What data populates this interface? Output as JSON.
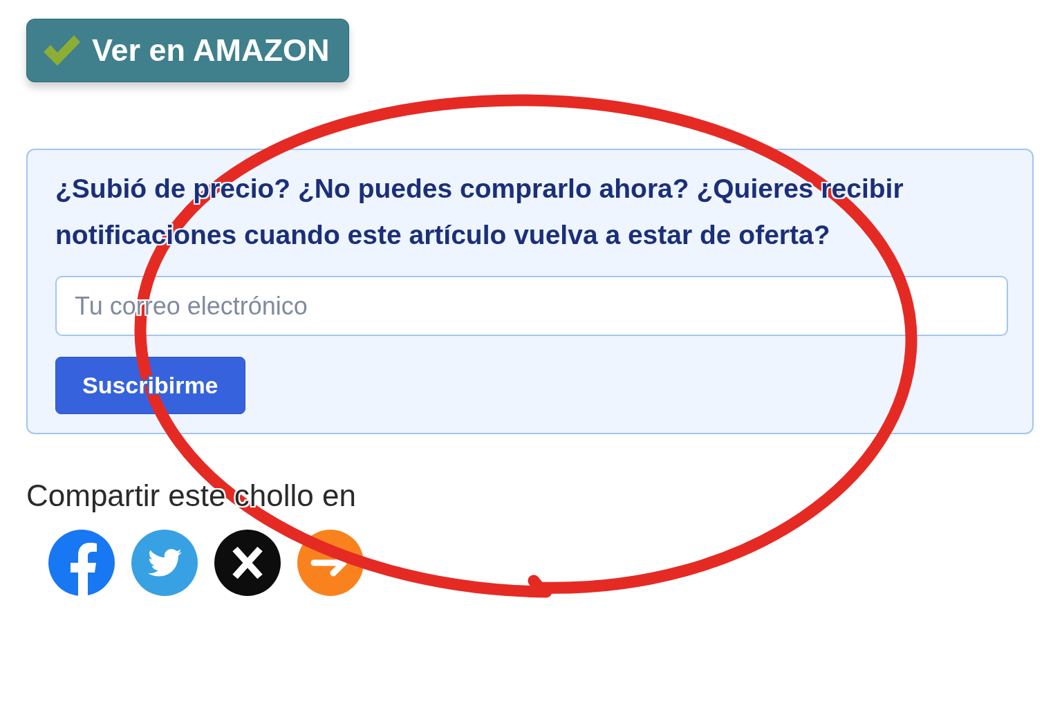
{
  "deal_button": {
    "label": "Ver en AMAZON"
  },
  "alert_box": {
    "question": "¿Subió de precio? ¿No puedes comprarlo ahora? ¿Quieres recibir notificaciones cuando este artículo vuelva a estar de oferta?",
    "email_field": {
      "placeholder": "Tu correo electrónico"
    },
    "subscribe_button": {
      "label": "Suscribirme"
    }
  },
  "share": {
    "heading": "Compartir este chollo en",
    "networks": [
      {
        "kind": "facebook"
      },
      {
        "kind": "twitter"
      },
      {
        "kind": "x"
      },
      {
        "kind": "other"
      }
    ]
  },
  "annotations": [
    {
      "kind": "ellipse"
    }
  ]
}
